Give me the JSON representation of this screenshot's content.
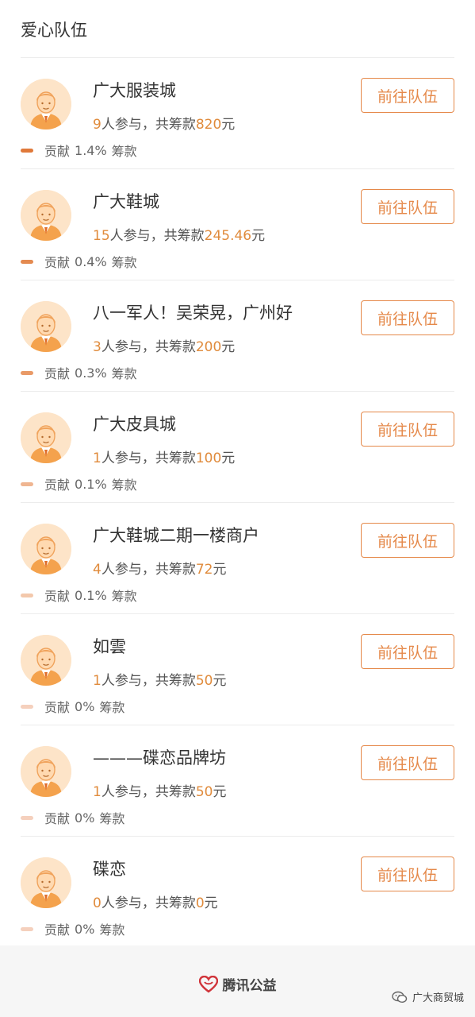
{
  "header": {
    "title": "爱心队伍"
  },
  "button_label": "前往队伍",
  "labels": {
    "people_suffix": "人参与，共筹款",
    "currency": "元",
    "contrib_prefix": "贡献",
    "contrib_suffix": "筹款"
  },
  "teams": [
    {
      "name": "广大服装城",
      "people": "9",
      "amount": "820",
      "percent": "1.4%",
      "bar_color": "#e0793a"
    },
    {
      "name": "广大鞋城",
      "people": "15",
      "amount": "245.46",
      "percent": "0.4%",
      "bar_color": "#e48a50"
    },
    {
      "name": "八一军人！吴荣晃，广州好",
      "people": "3",
      "amount": "200",
      "percent": "0.3%",
      "bar_color": "#e99a67"
    },
    {
      "name": "广大皮具城",
      "people": "1",
      "amount": "100",
      "percent": "0.1%",
      "bar_color": "#efb591"
    },
    {
      "name": "广大鞋城二期一楼商户",
      "people": "4",
      "amount": "72",
      "percent": "0.1%",
      "bar_color": "#f3c8ac"
    },
    {
      "name": "如雲",
      "people": "1",
      "amount": "50",
      "percent": "0%",
      "bar_color": "#f5d0bd"
    },
    {
      "name": "———碟恋品牌坊",
      "people": "1",
      "amount": "50",
      "percent": "0%",
      "bar_color": "#f5d0bd"
    },
    {
      "name": "碟恋",
      "people": "0",
      "amount": "0",
      "percent": "0%",
      "bar_color": "#f5d0bd"
    }
  ],
  "footer": {
    "brand": "腾讯公益",
    "brand_color": "#d0343a",
    "watermark": "广大商贸城"
  }
}
